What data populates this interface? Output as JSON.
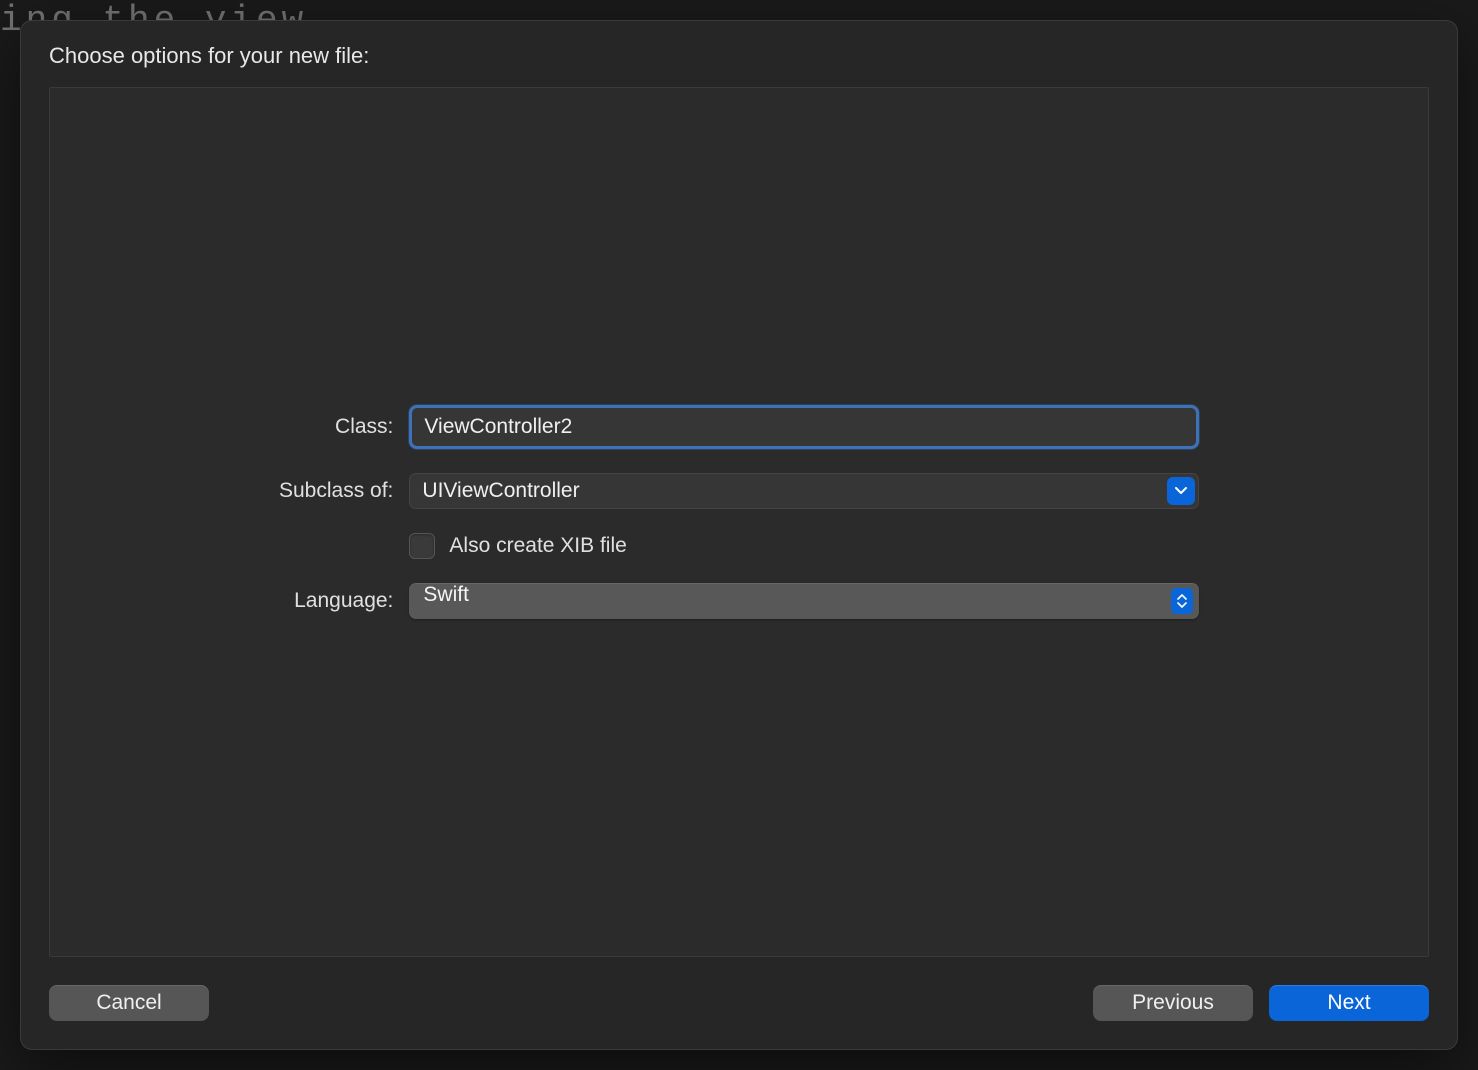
{
  "backdrop": "ing the view",
  "dialog": {
    "title": "Choose options for your new file:",
    "form": {
      "class_label": "Class:",
      "class_value": "ViewController2",
      "subclass_label": "Subclass of:",
      "subclass_value": "UIViewController",
      "xib_checkbox_label": "Also create XIB file",
      "xib_checked": false,
      "language_label": "Language:",
      "language_value": "Swift"
    },
    "buttons": {
      "cancel": "Cancel",
      "previous": "Previous",
      "next": "Next"
    }
  }
}
